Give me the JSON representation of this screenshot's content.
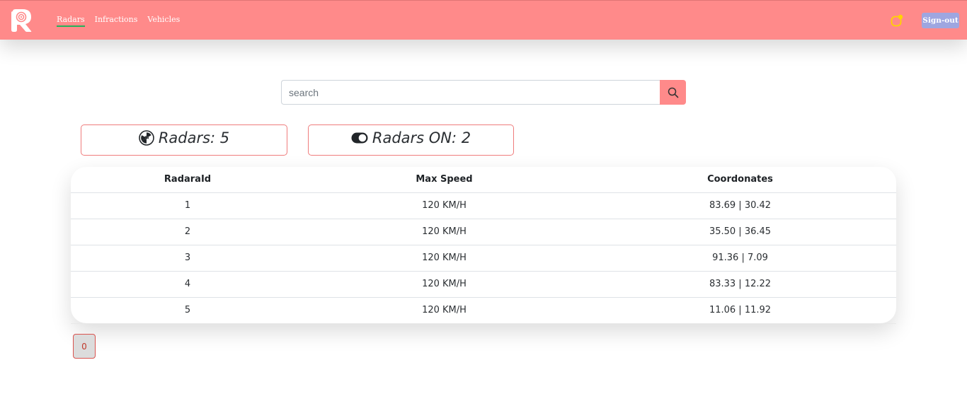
{
  "navbar": {
    "links": [
      "Radars",
      "Infractions",
      "Vehicles"
    ],
    "active_link": "Radars",
    "signout_label": "Sign-out"
  },
  "search": {
    "placeholder": "search",
    "value": ""
  },
  "stats": {
    "radars_label": "Radars: 5",
    "radars_on_label": "Radars ON: 2"
  },
  "table": {
    "headers": [
      "RadaraId",
      "Max Speed",
      "Coordonates"
    ],
    "rows": [
      [
        "1",
        "120 KM/H",
        "83.69 | 30.42"
      ],
      [
        "2",
        "120 KM/H",
        "35.50 | 36.45"
      ],
      [
        "3",
        "120 KM/H",
        "91.36 | 7.09"
      ],
      [
        "4",
        "120 KM/H",
        "83.33 | 12.22"
      ],
      [
        "5",
        "120 KM/H",
        "11.06 | 11.92"
      ]
    ]
  },
  "pagination": {
    "current_page": "0"
  },
  "colors": {
    "navbar": "#ff8a8a",
    "signout": "#9ea6e0",
    "active_underline": "#22b35a",
    "card_border": "#ef7c7c",
    "notification_dot": "#ffd400"
  },
  "icons": {
    "logo": "radar-logo-icon",
    "notification": "bell-notification-icon",
    "search": "search-icon",
    "radars": "radiation-icon",
    "radars_on": "toggle-on-icon"
  }
}
